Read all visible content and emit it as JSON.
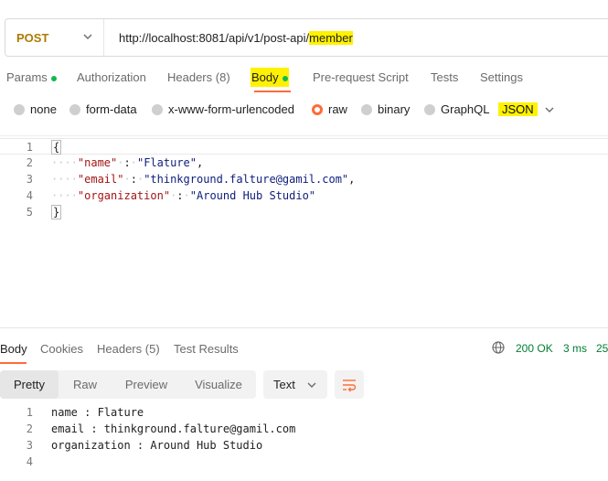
{
  "request": {
    "method": "POST",
    "url_prefix": "http://localhost:8081/api/v1/post-api/",
    "url_highlight": "member"
  },
  "tabs": {
    "params": "Params",
    "authorization": "Authorization",
    "headers": "Headers",
    "headers_count": "(8)",
    "body": "Body",
    "pre_request": "Pre-request Script",
    "tests": "Tests",
    "settings": "Settings"
  },
  "body_types": {
    "none": "none",
    "form_data": "form-data",
    "urlencoded": "x-www-form-urlencoded",
    "raw": "raw",
    "binary": "binary",
    "graphql": "GraphQL",
    "format": "JSON"
  },
  "editor": {
    "lines": [
      {
        "num": "1",
        "open": "{"
      },
      {
        "num": "2",
        "key": "\"name\"",
        "value": "\"Flature\""
      },
      {
        "num": "3",
        "key": "\"email\"",
        "value": "\"thinkground.falture@gamil.com\""
      },
      {
        "num": "4",
        "key": "\"organization\"",
        "value": "\"Around Hub Studio\""
      },
      {
        "num": "5",
        "close": "}"
      }
    ]
  },
  "response": {
    "tabs": {
      "body": "Body",
      "cookies": "Cookies",
      "headers": "Headers",
      "headers_count": "(5)",
      "test_results": "Test Results"
    },
    "status": "200 OK",
    "time": "3 ms",
    "size": "25",
    "view_modes": {
      "pretty": "Pretty",
      "raw": "Raw",
      "preview": "Preview",
      "visualize": "Visualize"
    },
    "format": "Text",
    "lines": [
      {
        "num": "1",
        "text": "name : Flature"
      },
      {
        "num": "2",
        "text": "email : thinkground.falture@gamil.com"
      },
      {
        "num": "3",
        "text": "organization : Around Hub Studio"
      },
      {
        "num": "4",
        "text": ""
      }
    ]
  },
  "colors": {
    "accent": "#ff6c37",
    "method": "#ad7a03",
    "status_ok": "#007f31",
    "highlight": "#fff200",
    "dot": "#0cbb52"
  }
}
